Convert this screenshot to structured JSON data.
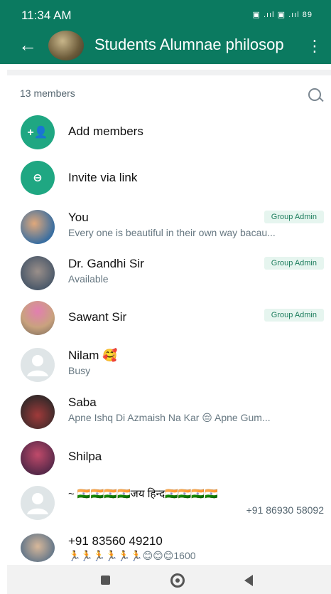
{
  "status": {
    "time": "11:34 AM",
    "right": "▣ .ııl ▣ .ııl 89"
  },
  "header": {
    "title": "Students Alumnae philosop"
  },
  "members": {
    "count_label": "13 members",
    "add_label": "Add members",
    "invite_label": "Invite via link"
  },
  "list": [
    {
      "name": "You",
      "status": "Every one is beautiful in their own way bacau...",
      "badge": "Group Admin"
    },
    {
      "name": "Dr. Gandhi Sir",
      "status": "Available",
      "badge": "Group Admin"
    },
    {
      "name": "Sawant Sir",
      "status": "",
      "badge": "Group Admin"
    },
    {
      "name": "Nilam 🥰",
      "status": "Busy"
    },
    {
      "name": "Saba",
      "status": "Apne Ishq Di Azmaish Na Kar 😔 Apne Gum..."
    },
    {
      "name": "Shilpa",
      "status": ""
    },
    {
      "name": "~ 🇮🇳🇮🇳🇮🇳🇮🇳जय हिन्द🇮🇳🇮🇳🇮🇳🇮🇳",
      "phone": "+91 86930 58092"
    },
    {
      "name": "+91 83560 49210",
      "status": "🏃🏃🏃🏃🏃🏃😊😊😊1600"
    }
  ],
  "colors": {
    "header": "#0b7a60",
    "accent": "#1fa782",
    "badge_bg": "#e6f5ef",
    "badge_text": "#1d7d5d"
  }
}
